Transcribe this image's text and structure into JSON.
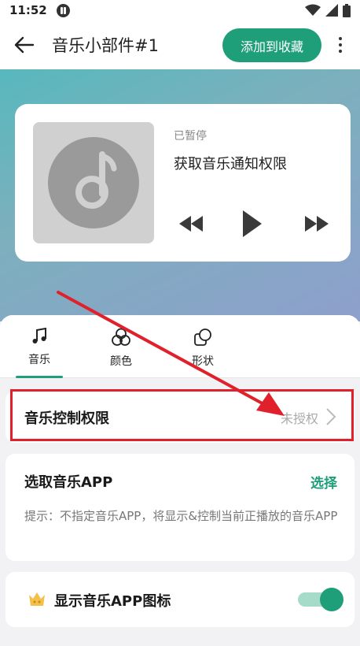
{
  "status_bar": {
    "time": "11:52"
  },
  "app_bar": {
    "title": "音乐小部件#1",
    "add_button": "添加到收藏"
  },
  "widget": {
    "status": "已暂停",
    "track_title": "获取音乐通知权限"
  },
  "tabs": [
    {
      "label": "音乐"
    },
    {
      "label": "颜色"
    },
    {
      "label": "形状"
    }
  ],
  "permission_row": {
    "title": "音乐控制权限",
    "status": "未授权"
  },
  "pick_app": {
    "title": "选取音乐APP",
    "action": "选择",
    "hint": "提示：不指定音乐APP，将显示&控制当前正播放的音乐APP"
  },
  "show_icon": {
    "title": "显示音乐APP图标",
    "enabled": true
  },
  "colors": {
    "accent": "#1f9e7a",
    "highlight": "#e0212b"
  }
}
